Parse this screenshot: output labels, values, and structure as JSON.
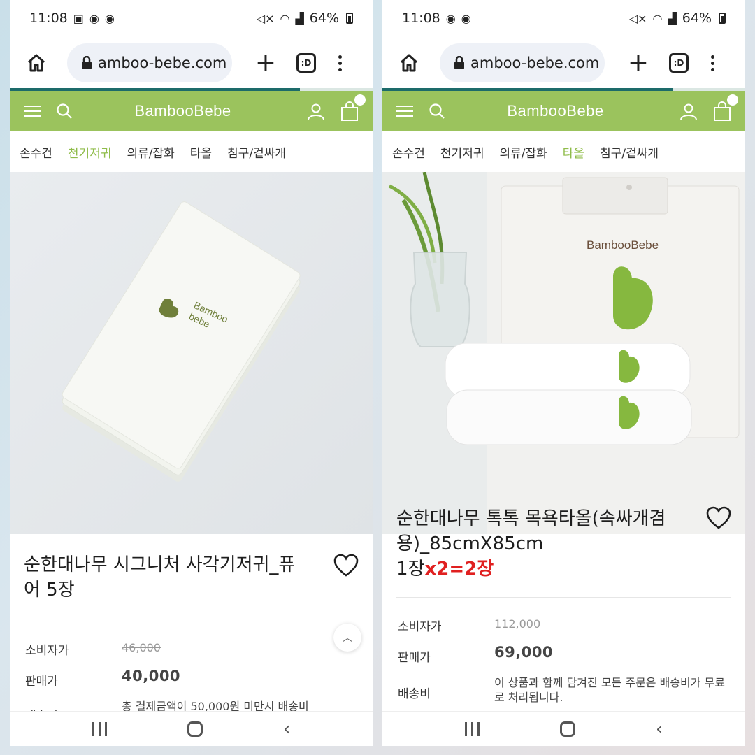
{
  "left": {
    "status": {
      "time": "11:08",
      "signal_text": "64%"
    },
    "browser": {
      "url": "amboo-bebe.com",
      "tab_count": ":D",
      "progress": 0.8
    },
    "site": {
      "brand": "BambooBebe"
    },
    "nav": [
      "손수건",
      "천기저귀",
      "의류/잡화",
      "타올",
      "침구/겉싸개"
    ],
    "active_nav": 1,
    "product": {
      "title_line1": "순한대나무 시그니처 사각기저귀_퓨",
      "title_line2": "어 5장",
      "image_label": "Bamboo bebe",
      "image_label_1": "Bamboo",
      "image_label_2": "bebe",
      "msrp_label": "소비자가",
      "msrp": "46,000",
      "price_label": "판매가",
      "price": "40,000",
      "ship_label": "배송비",
      "ship_note": "총 결제금액이 50,000원 미만시 배송비"
    }
  },
  "right": {
    "status": {
      "time": "11:08",
      "signal_text": "64%"
    },
    "browser": {
      "url": "amboo-bebe.com",
      "tab_count": ":D",
      "progress": 0.8
    },
    "site": {
      "brand": "BambooBebe"
    },
    "nav": [
      "손수건",
      "천기저귀",
      "의류/잡화",
      "타올",
      "침구/겉싸개"
    ],
    "active_nav": 3,
    "product": {
      "title_line1": "순한대나무 톡톡 목욕타올(속싸개겸",
      "title_line2": "용)_85cmX85cm",
      "qty_prefix": "1장",
      "qty_highlight": "x2=2장",
      "image_label": "BambooBebe",
      "msrp_label": "소비자가",
      "msrp": "112,000",
      "price_label": "판매가",
      "price": "69,000",
      "ship_label": "배송비",
      "ship_note": "이 상품과 함께 담겨진 모든 주문은 배송비가 무료로 처리됩니다."
    }
  },
  "colors": {
    "brand_green": "#9bc35d",
    "accent_red": "#e02020",
    "nav_active": "#8fbc4a"
  },
  "icons": [
    "home-icon",
    "lock-icon",
    "plus-icon",
    "tab-switcher-icon",
    "more-icon",
    "menu-icon",
    "search-icon",
    "user-icon",
    "cart-icon",
    "heart-icon",
    "chevron-up-icon"
  ]
}
